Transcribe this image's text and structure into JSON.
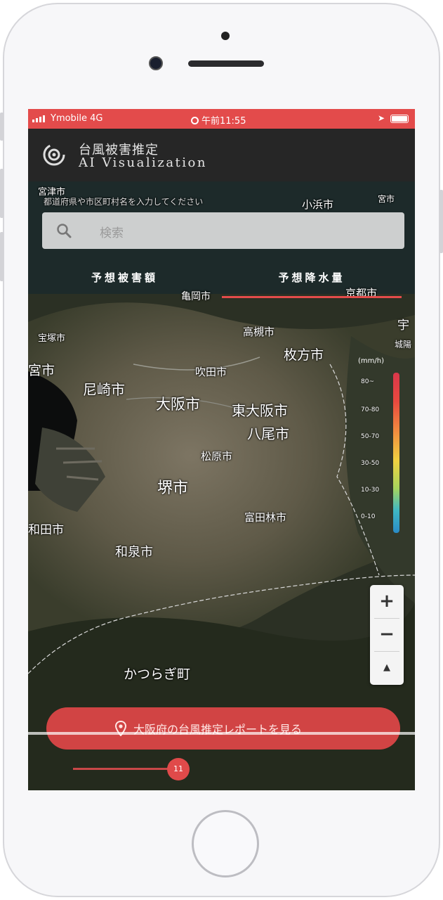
{
  "status_bar": {
    "carrier": "Ymobile 4G",
    "time": "午前11:55"
  },
  "app": {
    "title_jp": "台風被害推定",
    "title_en": "AI Visualization"
  },
  "search": {
    "placeholder": "検索",
    "hint": "都道府県や市区町村名を入力してください"
  },
  "tabs": [
    {
      "label": "予想被害額",
      "active": false
    },
    {
      "label": "予想降水量",
      "active": true
    }
  ],
  "map": {
    "places": {
      "p1": "宮津市",
      "p2": "小浜市",
      "p3": "京都市",
      "p4": "亀岡市",
      "p5": "宝塚市",
      "p6": "高槻市",
      "p7": "枚方市",
      "p8": "吹田市",
      "p9": "宮市",
      "p10": "尼崎市",
      "p11": "大阪市",
      "p12": "東大阪市",
      "p13": "八尾市",
      "p14": "松原市",
      "p15": "堺市",
      "p16": "富田林市",
      "p17": "和田市",
      "p18": "和泉市",
      "p19": "かつらぎ町",
      "p20": "宇",
      "p21": "城陽",
      "p22": "宮市"
    },
    "accent": "#e34b4b"
  },
  "legend": {
    "unit": "(mm/h)",
    "ticks": [
      "80~",
      "70-80",
      "50-70",
      "30-50",
      "10-30",
      "0-10"
    ]
  },
  "zoom": {
    "in": "+",
    "out": "−",
    "compass": "▲"
  },
  "cta": {
    "label": "大阪府の台風推定レポートを見る"
  },
  "slider": {
    "value": "11"
  }
}
